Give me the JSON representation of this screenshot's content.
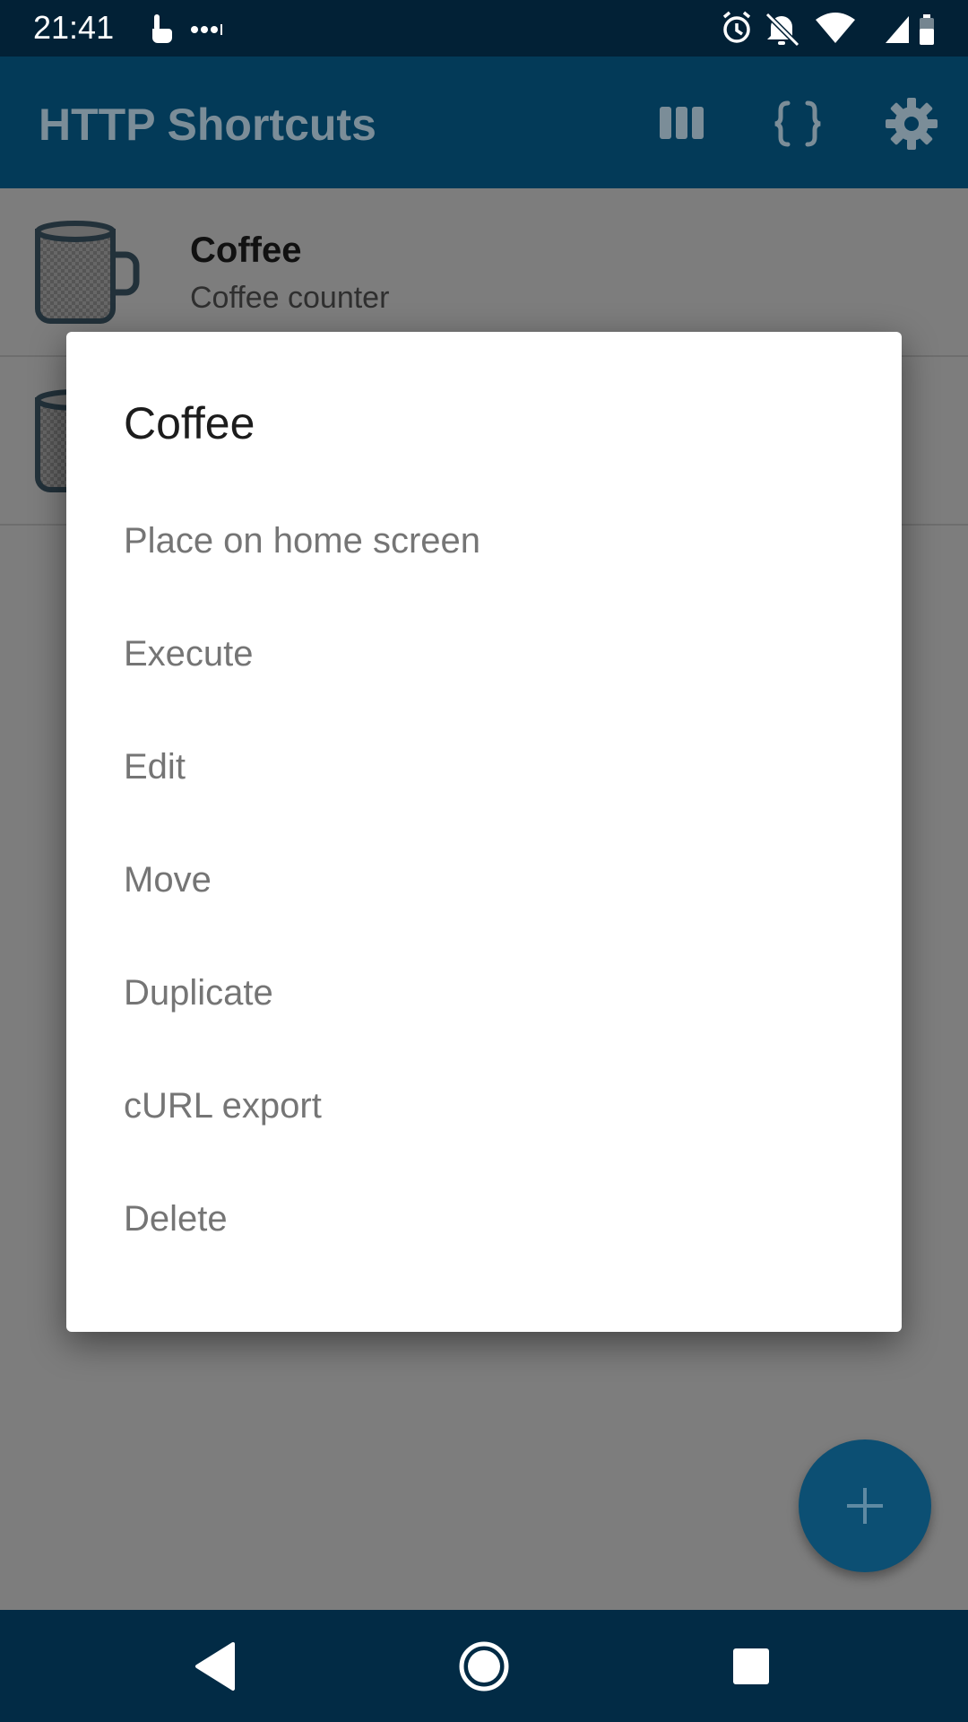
{
  "status_bar": {
    "time": "21:41",
    "left_icons": [
      "touch-icon",
      "more-dots-icon"
    ],
    "right_icons": [
      "alarm-icon",
      "notifications-off-icon",
      "wifi-icon",
      "cellular-signal-icon",
      "battery-icon"
    ]
  },
  "app_bar": {
    "title": "HTTP Shortcuts",
    "actions": [
      "columns-icon",
      "curly-braces-icon",
      "settings-icon"
    ],
    "background": "#033a58"
  },
  "shortcuts": [
    {
      "name": "Coffee",
      "description": "Coffee counter",
      "icon": "coffee-mug-icon"
    },
    {
      "name": "",
      "description": "",
      "icon": "coffee-mug-icon"
    }
  ],
  "dialog": {
    "title": "Coffee",
    "options": [
      "Place on home screen",
      "Execute",
      "Edit",
      "Move",
      "Duplicate",
      "cURL export",
      "Delete"
    ]
  },
  "fab": {
    "icon": "plus-icon",
    "color": "#0c4f73"
  },
  "nav_bar": {
    "buttons": [
      "back-icon",
      "home-icon",
      "recents-icon"
    ]
  }
}
